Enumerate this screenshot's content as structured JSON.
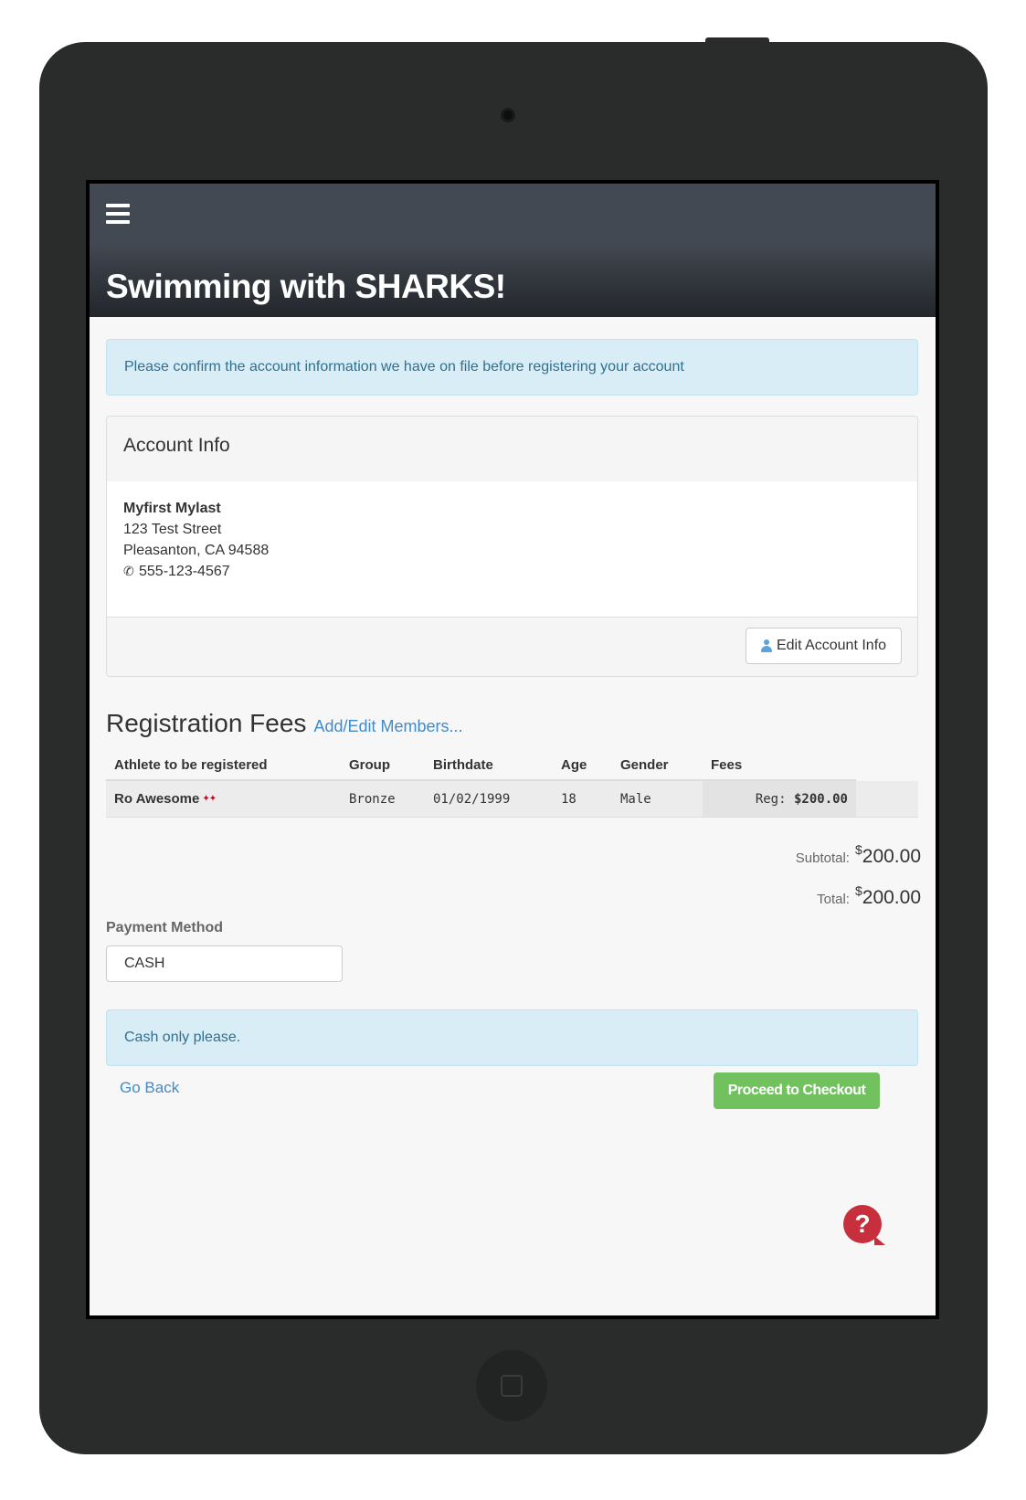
{
  "header": {
    "title": "Swimming with SHARKS!"
  },
  "alerts": {
    "confirm": "Please confirm the account information we have on file before registering your account",
    "cash": "Cash only please."
  },
  "account": {
    "heading": "Account Info",
    "name": "Myfirst Mylast",
    "street": "123 Test Street",
    "city_state_zip": "Pleasanton, CA 94588",
    "phone": "555-123-4567",
    "edit_button": "Edit Account Info"
  },
  "registration": {
    "title": "Registration Fees",
    "add_edit_link": "Add/Edit Members...",
    "columns": [
      "Athlete to be registered",
      "Group",
      "Birthdate",
      "Age",
      "Gender",
      "Fees"
    ],
    "rows": [
      {
        "athlete": "Ro Awesome",
        "group": "Bronze",
        "birthdate": "01/02/1999",
        "age": "18",
        "gender": "Male",
        "fee_label": "Reg:",
        "fee_amount": "$200.00"
      }
    ]
  },
  "totals": {
    "subtotal_label": "Subtotal:",
    "currency_symbol": "$",
    "subtotal_value": "200.00",
    "total_label": "Total:",
    "total_value": "200.00"
  },
  "payment": {
    "label": "Payment Method",
    "selected": "CASH"
  },
  "actions": {
    "go_back": "Go Back",
    "checkout": "Proceed to Checkout"
  },
  "colors": {
    "topbar": "#434953",
    "alert_bg": "#d9edf7",
    "alert_text": "#31708f",
    "link": "#428bca",
    "checkout_green": "#72c15f",
    "help_red": "#c62f3b"
  },
  "icons": {
    "menu": "hamburger-icon",
    "phone": "phone-icon",
    "user": "user-icon",
    "athlete_badge": "athlete-badge-icon",
    "help": "help-icon"
  }
}
